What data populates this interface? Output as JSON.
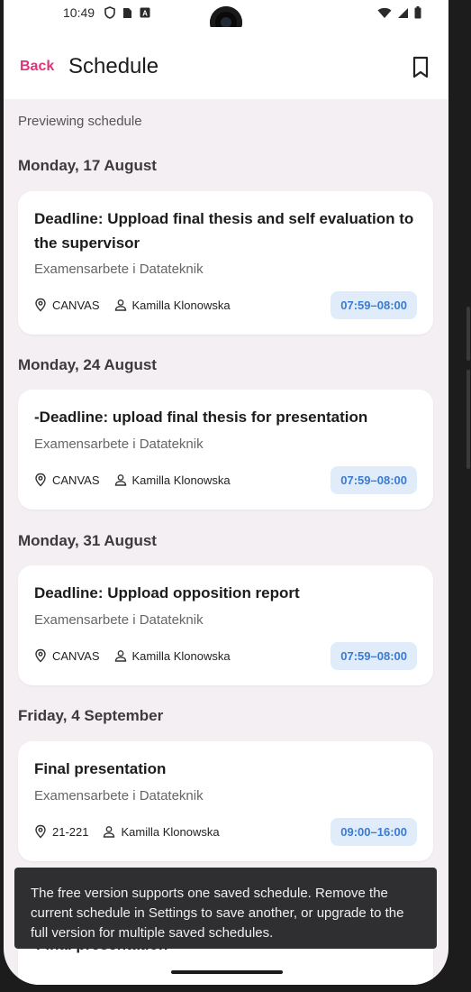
{
  "status_bar": {
    "time": "10:49"
  },
  "app_bar": {
    "back_label": "Back",
    "title": "Schedule"
  },
  "preview_label": "Previewing schedule",
  "days": [
    {
      "header": "Monday, 17 August",
      "events": [
        {
          "title": "Deadline: Uppload final thesis and self evaluation to the supervisor",
          "course": "Examensarbete i Datateknik",
          "location": "CANVAS",
          "teacher": "Kamilla Klonowska",
          "time": "07:59–08:00"
        }
      ]
    },
    {
      "header": "Monday, 24 August",
      "events": [
        {
          "title": "-Deadline: upload final thesis for presentation",
          "course": "Examensarbete i Datateknik",
          "location": "CANVAS",
          "teacher": "Kamilla Klonowska",
          "time": "07:59–08:00"
        }
      ]
    },
    {
      "header": "Monday, 31 August",
      "events": [
        {
          "title": "Deadline: Uppload opposition report",
          "course": "Examensarbete i Datateknik",
          "location": "CANVAS",
          "teacher": "Kamilla Klonowska",
          "time": "07:59–08:00"
        }
      ]
    },
    {
      "header": "Friday, 4 September",
      "events": [
        {
          "title": "Final presentation",
          "course": "Examensarbete i Datateknik",
          "location": "21-221",
          "teacher": "Kamilla Klonowska",
          "time": "09:00–16:00"
        }
      ]
    }
  ],
  "snackbar": {
    "message": "The free version supports one saved schedule. Remove the current schedule in Settings to save another, or upgrade to the full version for multiple saved schedules."
  },
  "peek_title": "Final presentation",
  "colors": {
    "accent": "#e0347a",
    "chip_bg": "#e1ecfa",
    "chip_text": "#3a7bd0",
    "background": "#f3eff3"
  }
}
